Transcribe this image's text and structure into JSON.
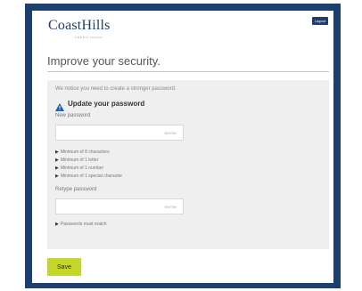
{
  "header": {
    "logo_text": "CoastHills",
    "logo_subtext": "CREDIT UNION",
    "logout_label": "Logout"
  },
  "page": {
    "title": "Improve your security."
  },
  "form": {
    "notice": "We notice you need to create a stronger password.",
    "heading": "Update your password",
    "new_password_label": "New password",
    "new_password_value": "",
    "show_label": "SHOW",
    "requirements": [
      "Minimum of 8 characters",
      "Minimum of 1 letter",
      "Minimum of 1 number",
      "Minimum of 1 special character"
    ],
    "retype_label": "Retype password",
    "retype_value": "",
    "match_requirement": "Passwords must match",
    "save_label": "Save"
  },
  "colors": {
    "frame": "#1d3f6e",
    "brand": "#1f3f69",
    "save_button": "#c4d62c",
    "warning_icon": "#1f5ea8"
  }
}
